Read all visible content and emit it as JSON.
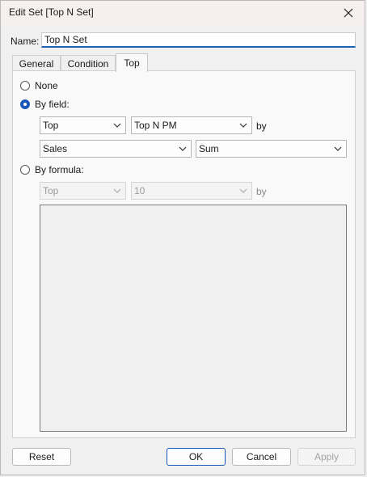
{
  "window": {
    "title": "Edit Set [Top N Set]",
    "close_icon": "close-icon"
  },
  "name_field": {
    "label": "Name:",
    "value": "Top N Set"
  },
  "tabs": [
    {
      "label": "General",
      "active": false
    },
    {
      "label": "Condition",
      "active": false
    },
    {
      "label": "Top",
      "active": true
    }
  ],
  "top_tab": {
    "options": {
      "none_label": "None",
      "by_field_label": "By field:",
      "by_formula_label": "By formula:",
      "selected": "by_field"
    },
    "by_field": {
      "direction": "Top",
      "count": "Top N PM",
      "by_label": "by",
      "field": "Sales",
      "aggregation": "Sum"
    },
    "by_formula": {
      "direction": "Top",
      "count": "10",
      "by_label": "by",
      "enabled": false
    }
  },
  "buttons": {
    "reset": "Reset",
    "ok": "OK",
    "cancel": "Cancel",
    "apply": "Apply"
  }
}
